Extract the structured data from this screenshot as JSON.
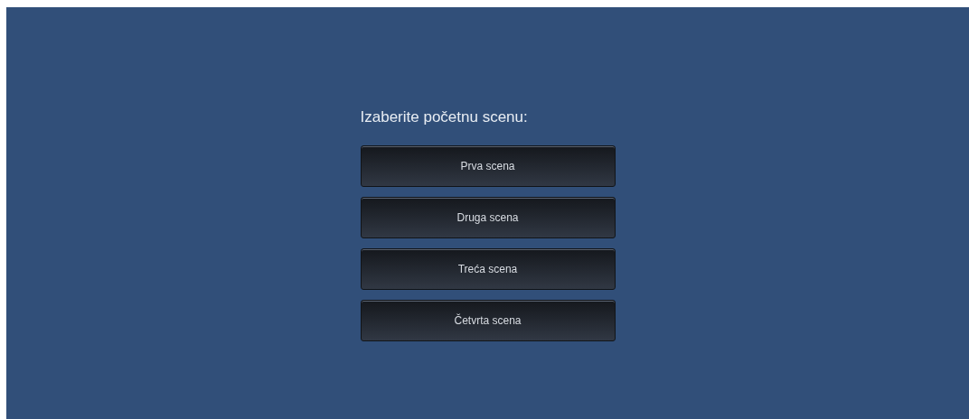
{
  "heading": "Izaberite početnu scenu:",
  "buttons": [
    "Prva scena",
    "Druga scena",
    "Treća scena",
    "Četvrta scena"
  ]
}
